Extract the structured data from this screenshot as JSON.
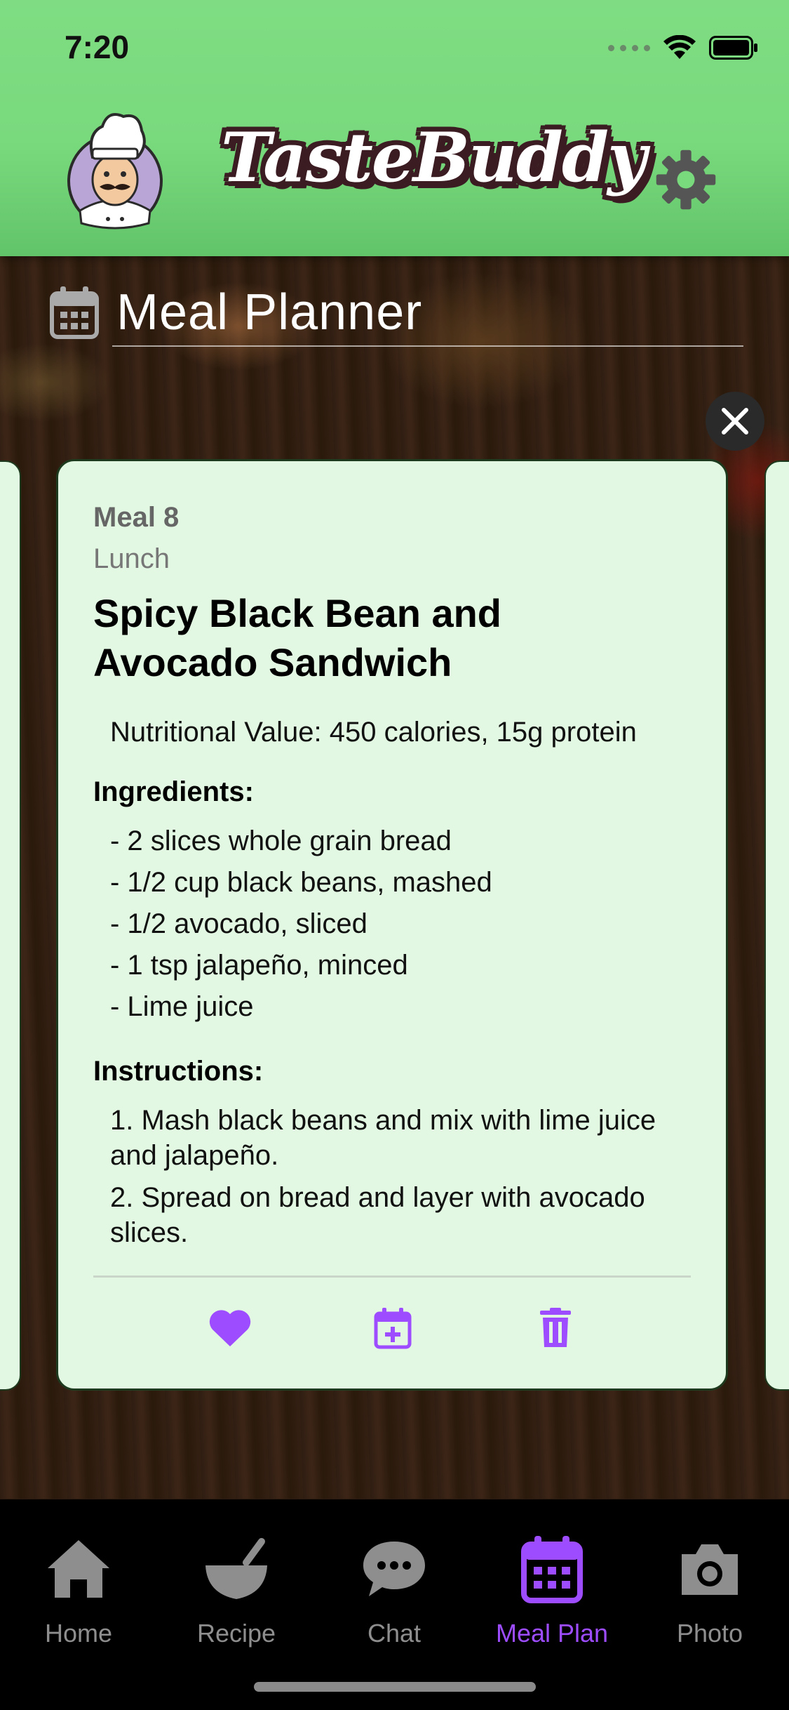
{
  "status": {
    "time": "7:20"
  },
  "app": {
    "title": "TasteBuddy"
  },
  "page": {
    "title": "Meal Planner"
  },
  "meal": {
    "number_label": "Meal 8",
    "type": "Lunch",
    "title": "Spicy Black Bean and Avocado Sandwich",
    "nutrition": "Nutritional Value: 450 calories, 15g protein",
    "ingredients_heading": "Ingredients:",
    "ingredients": [
      "- 2 slices whole grain bread",
      "- 1/2 cup black beans, mashed",
      "- 1/2 avocado, sliced",
      "- 1 tsp jalapeño, minced",
      "- Lime juice"
    ],
    "instructions_heading": "Instructions:",
    "instructions": [
      "1. Mash black beans and mix with lime juice and jalapeño.",
      "2. Spread on bread and layer with avocado slices."
    ]
  },
  "tabs": [
    {
      "label": "Home",
      "icon": "home-icon"
    },
    {
      "label": "Recipe",
      "icon": "bowl-icon"
    },
    {
      "label": "Chat",
      "icon": "chat-icon"
    },
    {
      "label": "Meal Plan",
      "icon": "calendar-icon",
      "active": true
    },
    {
      "label": "Photo",
      "icon": "camera-icon"
    }
  ],
  "colors": {
    "header_green": "#79d97d",
    "accent_purple": "#9d4dff",
    "card_bg": "#e2f8e2"
  }
}
